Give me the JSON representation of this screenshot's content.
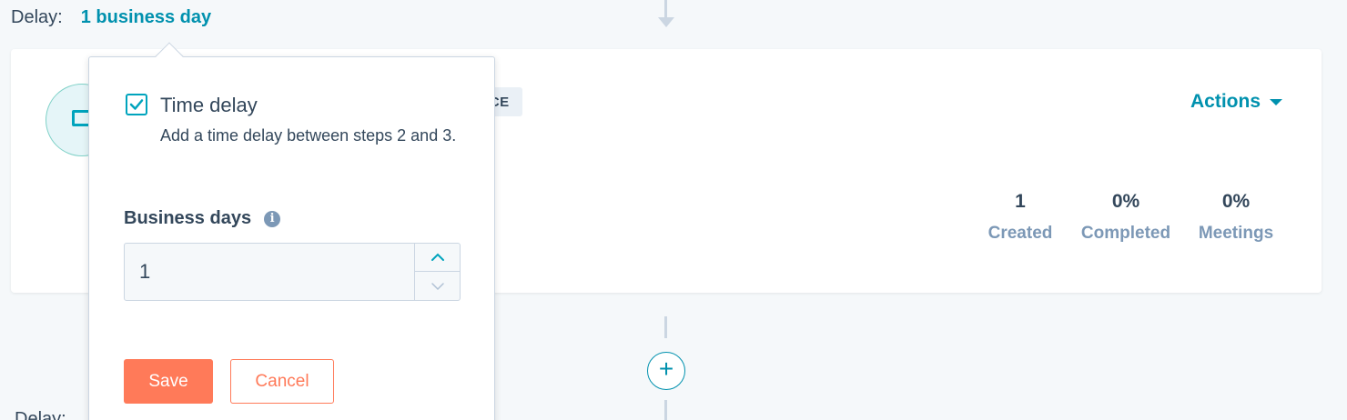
{
  "delay": {
    "label": "Delay:",
    "value": "1 business day"
  },
  "delay_next": {
    "label": "Delay:"
  },
  "card": {
    "badge": "ENCE",
    "actions_label": "Actions",
    "icon": "email-icon",
    "stats": [
      {
        "value": "1",
        "label": "Created"
      },
      {
        "value": "0%",
        "label": "Completed"
      },
      {
        "value": "0%",
        "label": "Meetings"
      }
    ]
  },
  "add_step": {
    "icon": "plus-icon",
    "label": "+"
  },
  "popover": {
    "checkbox_checked": true,
    "title": "Time delay",
    "description": "Add a time delay between steps 2 and 3.",
    "field_label": "Business days",
    "info_icon": "i",
    "field_value": "1",
    "save_label": "Save",
    "cancel_label": "Cancel"
  },
  "colors": {
    "accent": "#0091ae",
    "primary_button": "#ff7a59",
    "text": "#33475b",
    "muted": "#7c98b6",
    "background": "#f5f8fa"
  }
}
